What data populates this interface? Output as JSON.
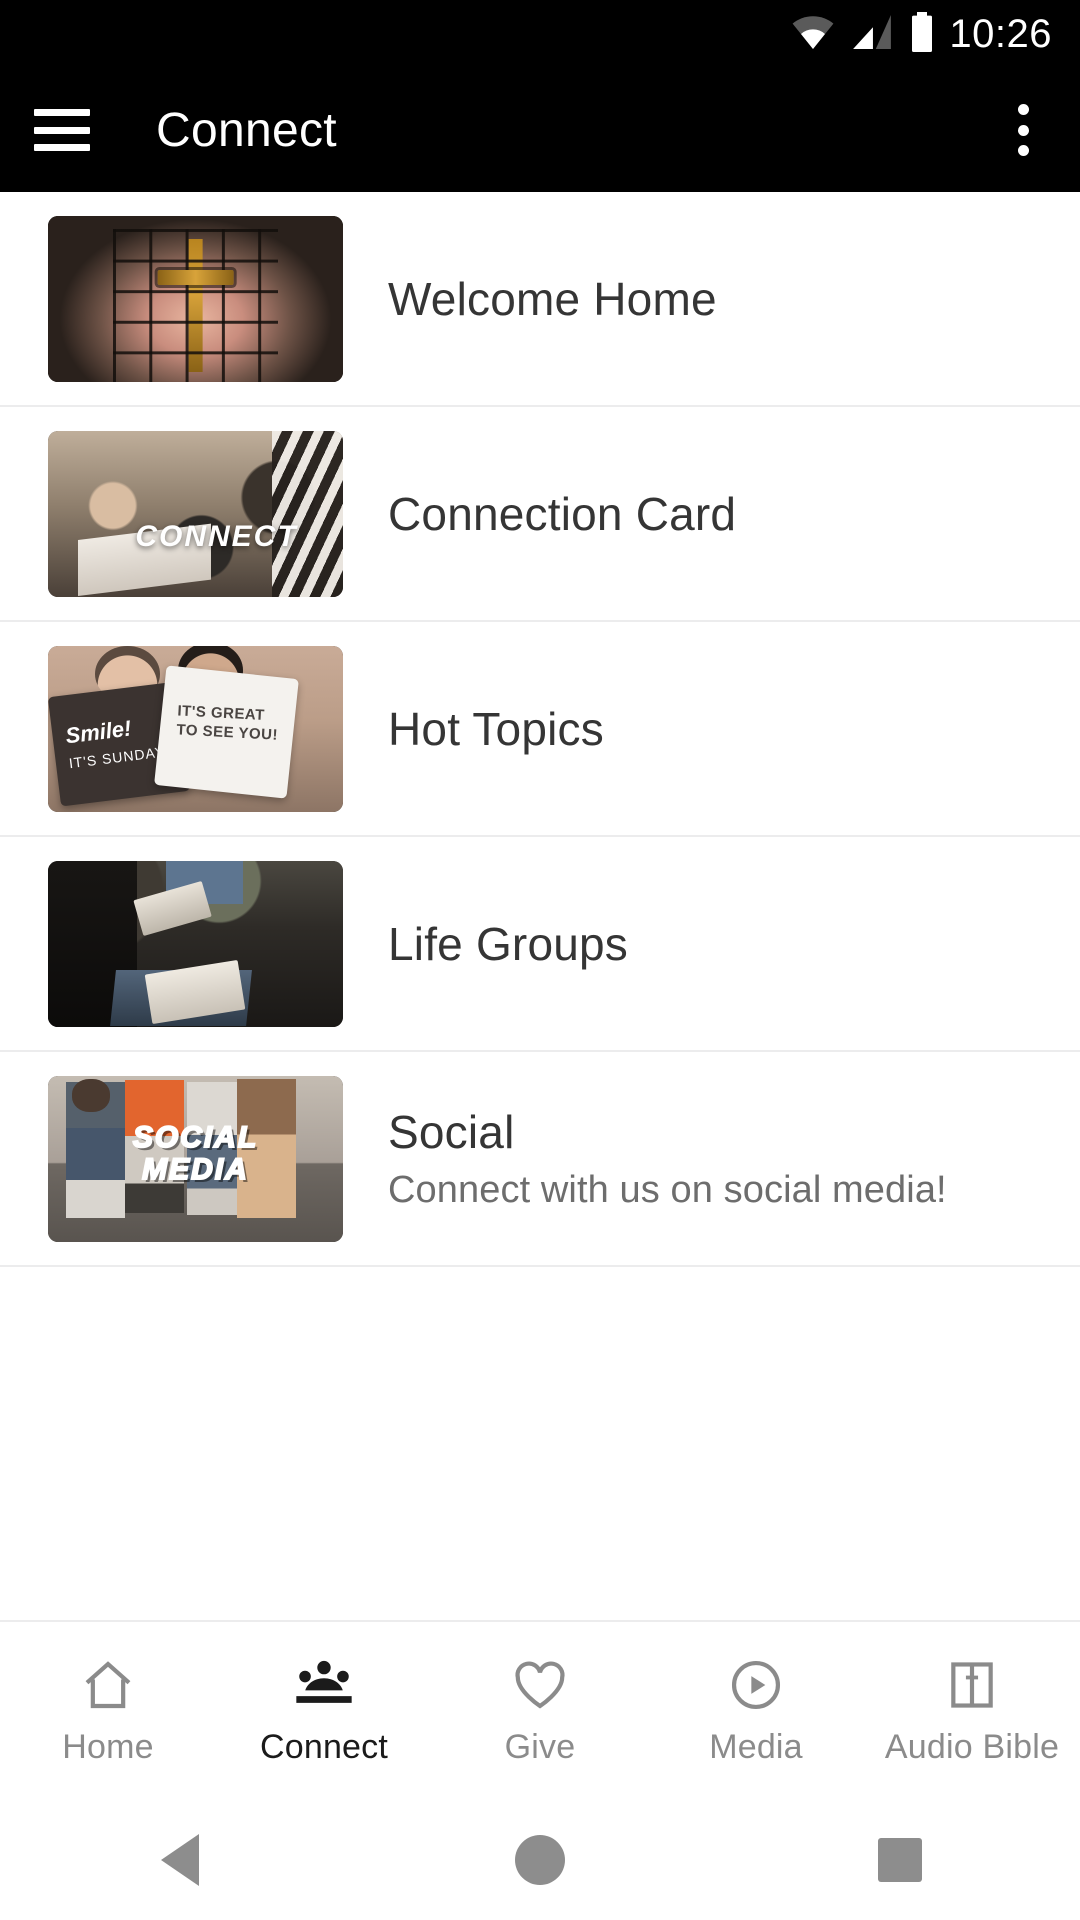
{
  "status_bar": {
    "time": "10:26",
    "icons": [
      "wifi-icon",
      "cellular-signal-icon",
      "battery-icon"
    ]
  },
  "app_bar": {
    "menu_icon": "hamburger-menu-icon",
    "title": "Connect",
    "overflow_icon": "more-vert-icon"
  },
  "list": {
    "items": [
      {
        "title": "Welcome Home",
        "subtitle": "",
        "thumb_overlay": "",
        "thumb_name": "church-window-cross-thumbnail"
      },
      {
        "title": "Connection Card",
        "subtitle": "",
        "thumb_overlay": "CONNECT",
        "thumb_name": "small-group-connect-thumbnail"
      },
      {
        "title": "Hot Topics",
        "subtitle": "",
        "thumb_overlay": "",
        "thumb_name": "smile-its-sunday-signs-thumbnail",
        "sign_dark_line1": "Smile!",
        "sign_dark_line2": "IT'S SUNDAY",
        "sign_light_line1": "IT'S GREAT",
        "sign_light_line2": "TO SEE YOU!"
      },
      {
        "title": "Life Groups",
        "subtitle": "",
        "thumb_overlay": "",
        "thumb_name": "seated-bible-study-thumbnail"
      },
      {
        "title": "Social",
        "subtitle": "Connect with us on social media!",
        "thumb_overlay_line1": "SOCIAL",
        "thumb_overlay_line2": "MEDIA",
        "thumb_name": "social-media-people-thumbnail"
      }
    ]
  },
  "tab_bar": {
    "tabs": [
      {
        "label": "Home",
        "icon": "home-icon",
        "active": false
      },
      {
        "label": "Connect",
        "icon": "people-group-icon",
        "active": true
      },
      {
        "label": "Give",
        "icon": "heart-icon",
        "active": false
      },
      {
        "label": "Media",
        "icon": "play-circle-icon",
        "active": false
      },
      {
        "label": "Audio Bible",
        "icon": "bible-book-icon",
        "active": false
      }
    ]
  },
  "nav_bar": {
    "back": "back-triangle-icon",
    "home": "home-circle-icon",
    "recents": "recents-square-icon"
  },
  "colors": {
    "app_bar_bg": "#000000",
    "page_bg": "#ffffff",
    "title_text": "#353535",
    "subtitle_text": "#6d6d6d",
    "divider": "#ececed",
    "tab_inactive": "#8b8b8b",
    "tab_active": "#1b1b1b"
  }
}
